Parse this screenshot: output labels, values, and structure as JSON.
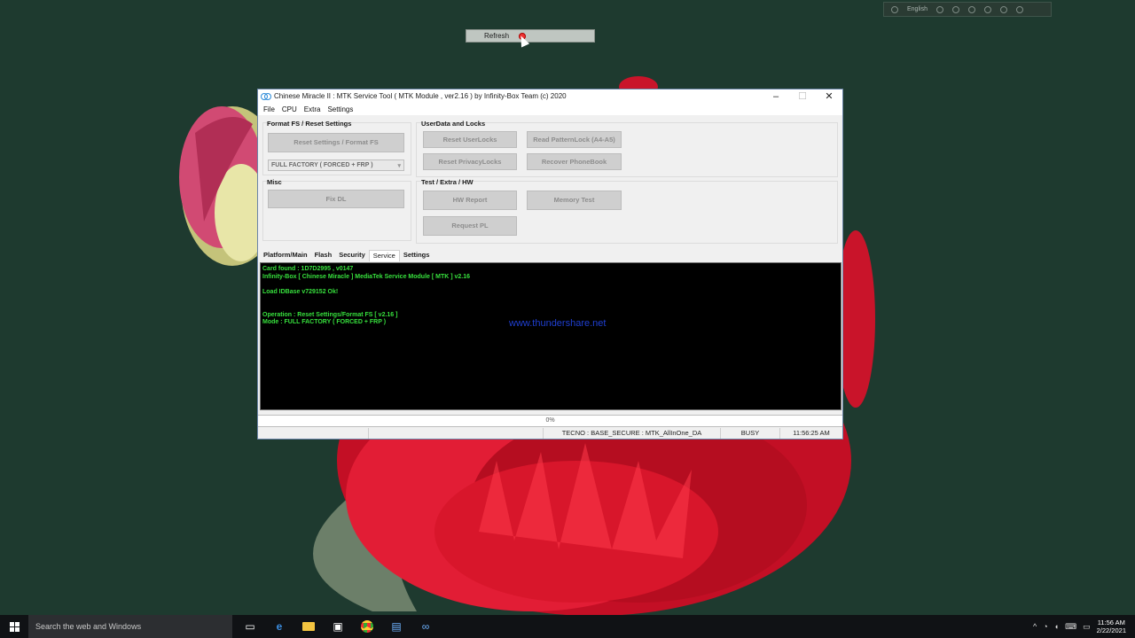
{
  "desktop": {
    "langbar": {
      "language": "English"
    },
    "refresh_bar": {
      "label": "Refresh"
    }
  },
  "window": {
    "title": "Chinese Miracle II : MTK Service Tool ( MTK Module , ver2.16 ) by Infinity-Box Team (c) 2020",
    "controls": {
      "minimize": "–",
      "maximize": "☐",
      "close": "✕"
    },
    "menu": [
      "File",
      "CPU",
      "Extra",
      "Settings"
    ],
    "groups": {
      "format": {
        "title": "Format FS / Reset Settings",
        "button": "Reset Settings / Format FS",
        "combo_value": "FULL FACTORY ( FORCED + FRP )"
      },
      "misc": {
        "title": "Misc",
        "button": "Fix DL"
      },
      "userdata": {
        "title": "UserData  and Locks",
        "buttons": [
          "Reset UserLocks",
          "Read PatternLock (A4-A5)",
          "Reset PrivacyLocks",
          "Recover PhoneBook"
        ]
      },
      "test": {
        "title": "Test / Extra / HW",
        "buttons": [
          "HW Report",
          "Memory Test",
          "Request PL"
        ]
      }
    },
    "tabs": [
      "Platform/Main",
      "Flash",
      "Security",
      "Service",
      "Settings"
    ],
    "active_tab": "Service",
    "console": {
      "lines": [
        "Card found : 1D7D2995 , v0147",
        "Infinity-Box [ Chinese Miracle ] MediaTek Service Module [ MTK ] v2.16",
        "",
        "Load IDBase v729152 Ok!",
        "",
        "",
        "Operation : Reset Settings/Format FS [ v2.16 ]",
        "Mode : FULL FACTORY ( FORCED + FRP )"
      ],
      "watermark": "www.thundershare.net"
    },
    "progress": {
      "text": "0%",
      "value": 0
    },
    "status": {
      "device": "TECNO : BASE_SECURE : MTK_AllInOne_DA",
      "state": "BUSY",
      "time": "11:56:25 AM"
    }
  },
  "taskbar": {
    "search_placeholder": "Search the web and Windows",
    "clock_time": "11:56 AM",
    "clock_date": "2/22/2021"
  },
  "colors": {
    "console_text": "#37e03d",
    "watermark": "#1f3fd1",
    "flower": "#d8152c"
  }
}
